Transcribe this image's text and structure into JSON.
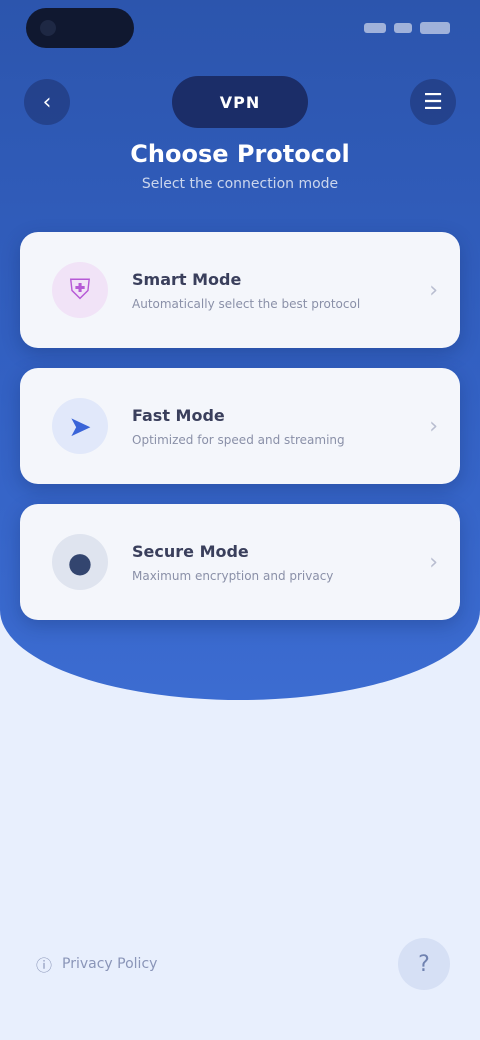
{
  "header": {
    "back_icon": "back-arrow-icon",
    "logo_text": "VPN",
    "menu_icon": "menu-icon",
    "title": "Choose Protocol",
    "subtitle": "Select the connection mode"
  },
  "options": [
    {
      "title": "Smart Mode",
      "description": "Automatically select the best protocol",
      "icon": "shield-icon",
      "color": "#b65ad6"
    },
    {
      "title": "Fast Mode",
      "description": "Optimized for speed and streaming",
      "icon": "rocket-icon",
      "color": "#3a64d8"
    },
    {
      "title": "Secure Mode",
      "description": "Maximum encryption and privacy",
      "icon": "lock-icon",
      "color": "#33456f"
    }
  ],
  "footer": {
    "link_label": "Privacy Policy",
    "link_icon": "info-icon",
    "action_icon": "help-icon"
  }
}
